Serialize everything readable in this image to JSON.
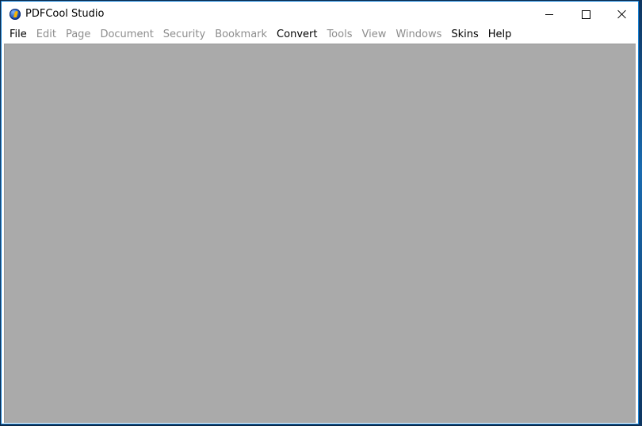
{
  "window": {
    "title": "PDFCool Studio",
    "accent_color": "#1883d7",
    "icon": "pdfcool-app-icon"
  },
  "title_buttons": {
    "minimize_icon": "minimize-icon",
    "maximize_icon": "maximize-icon",
    "close_icon": "close-icon"
  },
  "menu": {
    "items": [
      {
        "label": "File",
        "enabled": true
      },
      {
        "label": "Edit",
        "enabled": false
      },
      {
        "label": "Page",
        "enabled": false
      },
      {
        "label": "Document",
        "enabled": false
      },
      {
        "label": "Security",
        "enabled": false
      },
      {
        "label": "Bookmark",
        "enabled": false
      },
      {
        "label": "Convert",
        "enabled": true
      },
      {
        "label": "Tools",
        "enabled": false
      },
      {
        "label": "View",
        "enabled": false
      },
      {
        "label": "Windows",
        "enabled": false
      },
      {
        "label": "Skins",
        "enabled": true
      },
      {
        "label": "Help",
        "enabled": true
      }
    ],
    "enabled_color": "#000000",
    "disabled_color": "#8d8d8d"
  },
  "workspace": {
    "background_color": "#aaaaaa"
  }
}
